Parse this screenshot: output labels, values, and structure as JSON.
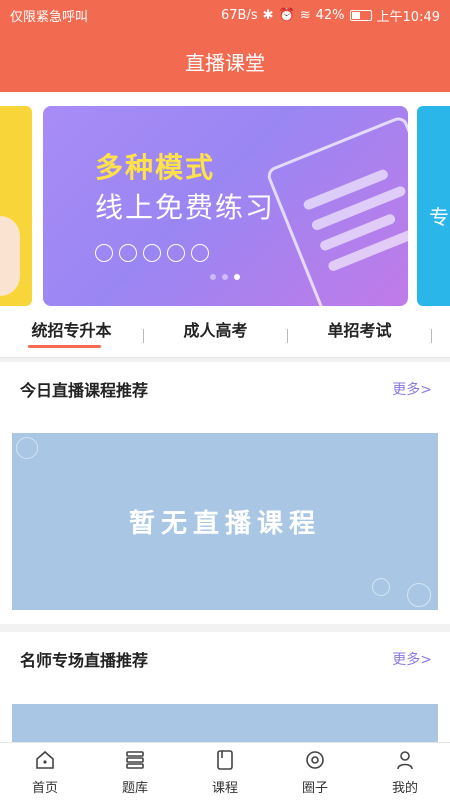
{
  "status_bar": {
    "left_text": "仅限紧急呼叫",
    "speed": "67B/s",
    "battery": "42%",
    "time": "上午10:49"
  },
  "header": {
    "title": "直播课堂"
  },
  "banner": {
    "title_line1": "多种模式",
    "title_line2": "线上免费练习",
    "right_card_text": "专",
    "slide_count": 3,
    "active_slide": 3
  },
  "tabs": [
    {
      "label": "统招专升本",
      "active": true
    },
    {
      "label": "成人高考",
      "active": false
    },
    {
      "label": "单招考试",
      "active": false
    }
  ],
  "today_section": {
    "title": "今日直播课程推荐",
    "more": "更多>",
    "empty_text": "暂无直播课程"
  },
  "teacher_section": {
    "title": "名师专场直播推荐",
    "more": "更多>"
  },
  "bottom_nav": [
    {
      "label": "首页",
      "icon": "home-icon"
    },
    {
      "label": "题库",
      "icon": "question-bank-icon"
    },
    {
      "label": "课程",
      "icon": "course-icon"
    },
    {
      "label": "圈子",
      "icon": "circle-icon"
    },
    {
      "label": "我的",
      "icon": "profile-icon"
    }
  ],
  "colors": {
    "brand": "#f26b51",
    "more_link": "#8a7ae2",
    "empty_box": "#a9c7e4",
    "banner_title": "#ffe14a"
  }
}
